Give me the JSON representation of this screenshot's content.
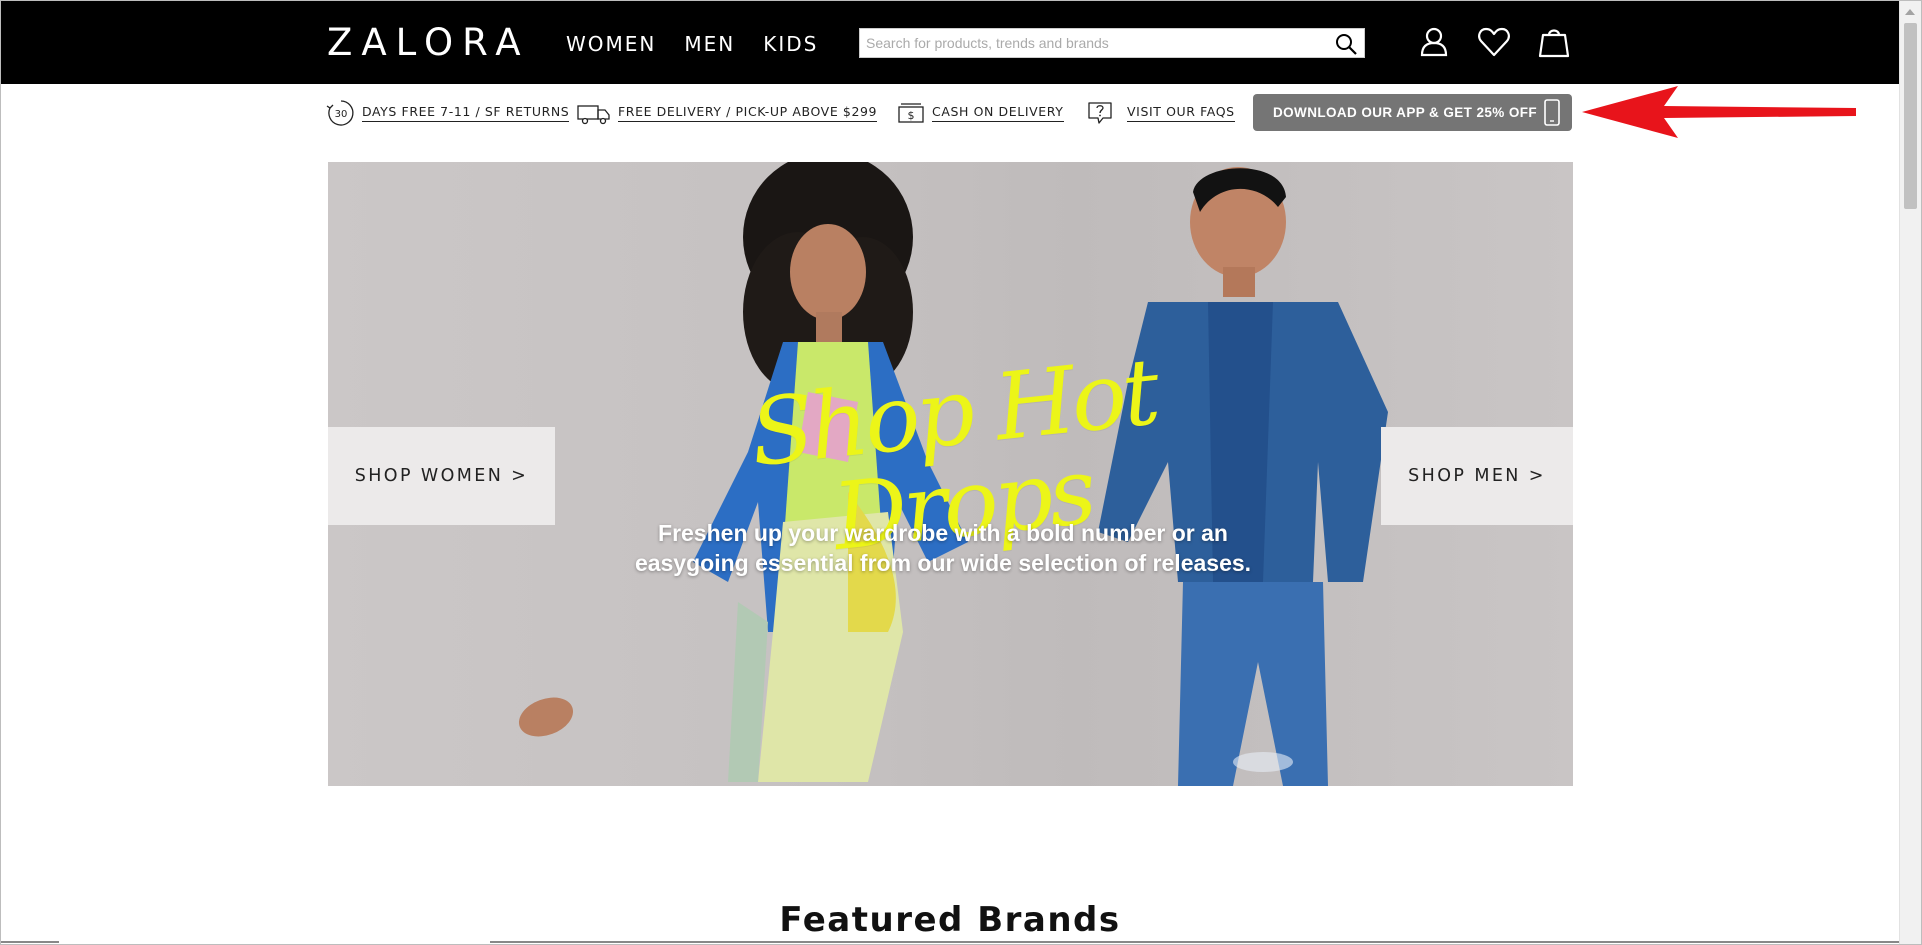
{
  "header": {
    "logo": "ZALORA",
    "nav": [
      "WOMEN",
      "MEN",
      "KIDS"
    ],
    "search_placeholder": "Search for products, trends and brands",
    "icons": [
      "search-icon",
      "account-icon",
      "wishlist-heart-icon",
      "shopping-bag-icon"
    ]
  },
  "usp": {
    "returns_badge": "30",
    "returns": "DAYS FREE 7-11 / SF RETURNS",
    "delivery": "FREE DELIVERY / PICK-UP ABOVE $299",
    "cod_badge": "$",
    "cod": "CASH ON DELIVERY",
    "faqs": "VISIT OUR FAQS",
    "app": "DOWNLOAD OUR APP & GET 25% OFF"
  },
  "hero": {
    "title": "Shop Hot Drops",
    "subtitle_line1": "Freshen up your wardrobe with a bold number or an",
    "subtitle_line2": "easygoing essential from our wide selection of releases.",
    "shop_women": "SHOP WOMEN >",
    "shop_men": "SHOP MEN >"
  },
  "featured": {
    "title": "Featured Brands"
  },
  "colors": {
    "header_bg": "#000000",
    "app_button": "#757575",
    "annotation_arrow": "#e8141b",
    "hero_title": "#ecf518"
  }
}
